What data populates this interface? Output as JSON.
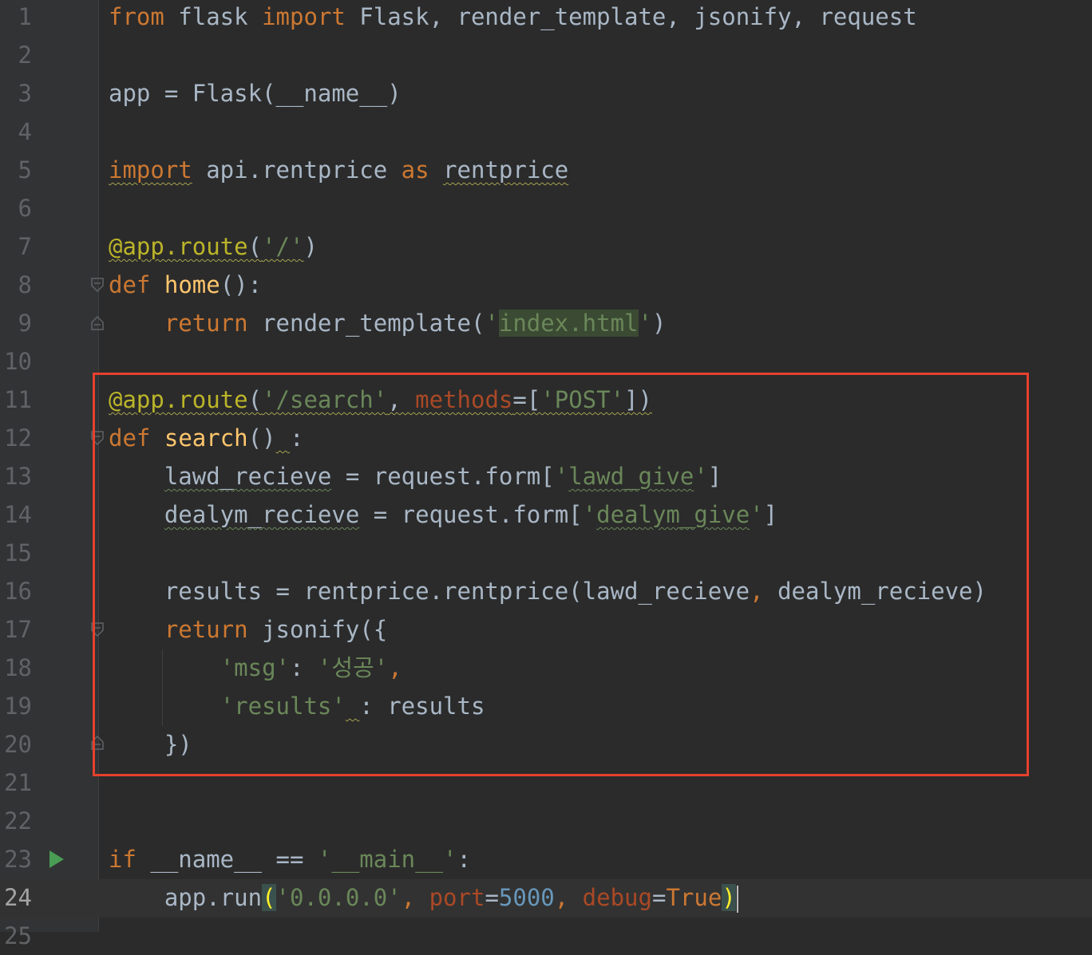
{
  "editor": {
    "lines": [
      {
        "num": "1"
      },
      {
        "num": "2"
      },
      {
        "num": "3"
      },
      {
        "num": "4"
      },
      {
        "num": "5"
      },
      {
        "num": "6"
      },
      {
        "num": "7"
      },
      {
        "num": "8"
      },
      {
        "num": "9"
      },
      {
        "num": "10"
      },
      {
        "num": "11"
      },
      {
        "num": "12"
      },
      {
        "num": "13"
      },
      {
        "num": "14"
      },
      {
        "num": "15"
      },
      {
        "num": "16"
      },
      {
        "num": "17"
      },
      {
        "num": "18"
      },
      {
        "num": "19"
      },
      {
        "num": "20"
      },
      {
        "num": "21"
      },
      {
        "num": "22"
      },
      {
        "num": "23"
      },
      {
        "num": "24"
      },
      {
        "num": "25"
      }
    ],
    "current_line": "24",
    "colors": {
      "background": "#2b2b2b",
      "keyword": "#cc7832",
      "string": "#6a8759",
      "number": "#6897bb",
      "decorator": "#bbb529",
      "function": "#ffc66d",
      "text": "#a9b7c6",
      "highlight_box": "#e5412d"
    },
    "code": {
      "l1": {
        "kw_from": "from",
        "mod": " flask ",
        "kw_import": "import",
        "names": " Flask, render_template, jsonify, request"
      },
      "l3": {
        "text": "app = Flask(__name__)"
      },
      "l5": {
        "kw_import": "import",
        "mod": " api.rentprice ",
        "kw_as": "as",
        "sp": " ",
        "alias": "rentprice"
      },
      "l7": {
        "dec": "@app.route",
        "open": "(",
        "str": "'/'",
        "close": ")"
      },
      "l8": {
        "kw": "def",
        "sp": " ",
        "fn": "home",
        "rest": "():"
      },
      "l9": {
        "indent": "    ",
        "kw": "return",
        "call": " render_template(",
        "q1": "'",
        "str": "index.html",
        "q2": "'",
        "close": ")"
      },
      "l11": {
        "dec": "@app.route",
        "open": "(",
        "str": "'/search'",
        "comma": ", ",
        "param": "methods",
        "eq": "=[",
        "str2": "'POST'",
        "close": "])"
      },
      "l12": {
        "kw": "def",
        "sp": " ",
        "fn": "search",
        "paren": "()",
        "space": " ",
        "colon": ":"
      },
      "l13": {
        "indent": "    ",
        "var": "lawd_recieve",
        "mid": " = request.form[",
        "q1": "'",
        "str": "lawd_give",
        "q2": "'",
        "close": "]"
      },
      "l14": {
        "indent": "    ",
        "var": "dealym_recieve",
        "mid": " = request.form[",
        "q1": "'",
        "str": "dealym_give",
        "q2": "'",
        "close": "]"
      },
      "l16": {
        "indent": "    ",
        "a": "results = rentprice.rentprice(lawd_recieve",
        "comma": ",",
        "b": " dealym_recieve)"
      },
      "l17": {
        "indent": "    ",
        "kw": "return",
        "rest": " jsonify({"
      },
      "l18": {
        "indent": "        ",
        "key": "'msg'",
        "colon": ": ",
        "val": "'성공'",
        "comma": ","
      },
      "l19": {
        "indent": "        ",
        "key": "'results'",
        "space": " ",
        "rest": ": results"
      },
      "l20": {
        "indent": "    ",
        "rest": "})"
      },
      "l23": {
        "kw": "if",
        "mid": " __name__ == ",
        "str": "'__main__'",
        "rest": ":"
      },
      "l24": {
        "indent": "    ",
        "call": "app.run",
        "open": "(",
        "str": "'0.0.0.0'",
        "comma1": ", ",
        "p1": "port",
        "eq1": "=",
        "num": "5000",
        "comma2": ", ",
        "p2": "debug",
        "eq2": "=",
        "val": "True",
        "close": ")"
      }
    }
  }
}
